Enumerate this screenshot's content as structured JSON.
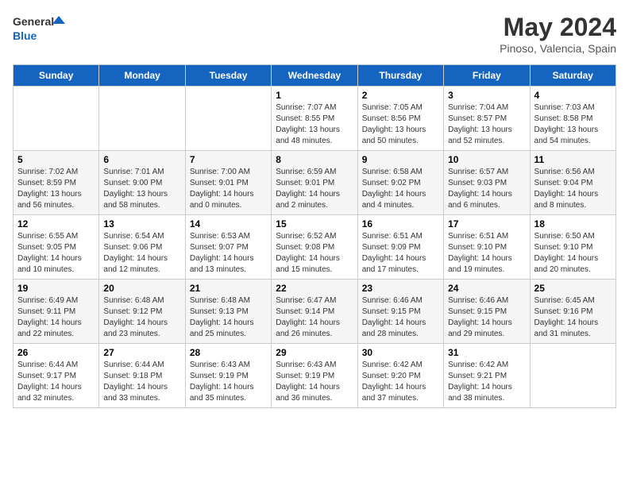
{
  "header": {
    "logo_general": "General",
    "logo_blue": "Blue",
    "title": "May 2024",
    "location": "Pinoso, Valencia, Spain"
  },
  "days_of_week": [
    "Sunday",
    "Monday",
    "Tuesday",
    "Wednesday",
    "Thursday",
    "Friday",
    "Saturday"
  ],
  "weeks": [
    [
      {
        "day": "",
        "info": ""
      },
      {
        "day": "",
        "info": ""
      },
      {
        "day": "",
        "info": ""
      },
      {
        "day": "1",
        "info": "Sunrise: 7:07 AM\nSunset: 8:55 PM\nDaylight: 13 hours\nand 48 minutes."
      },
      {
        "day": "2",
        "info": "Sunrise: 7:05 AM\nSunset: 8:56 PM\nDaylight: 13 hours\nand 50 minutes."
      },
      {
        "day": "3",
        "info": "Sunrise: 7:04 AM\nSunset: 8:57 PM\nDaylight: 13 hours\nand 52 minutes."
      },
      {
        "day": "4",
        "info": "Sunrise: 7:03 AM\nSunset: 8:58 PM\nDaylight: 13 hours\nand 54 minutes."
      }
    ],
    [
      {
        "day": "5",
        "info": "Sunrise: 7:02 AM\nSunset: 8:59 PM\nDaylight: 13 hours\nand 56 minutes."
      },
      {
        "day": "6",
        "info": "Sunrise: 7:01 AM\nSunset: 9:00 PM\nDaylight: 13 hours\nand 58 minutes."
      },
      {
        "day": "7",
        "info": "Sunrise: 7:00 AM\nSunset: 9:01 PM\nDaylight: 14 hours\nand 0 minutes."
      },
      {
        "day": "8",
        "info": "Sunrise: 6:59 AM\nSunset: 9:01 PM\nDaylight: 14 hours\nand 2 minutes."
      },
      {
        "day": "9",
        "info": "Sunrise: 6:58 AM\nSunset: 9:02 PM\nDaylight: 14 hours\nand 4 minutes."
      },
      {
        "day": "10",
        "info": "Sunrise: 6:57 AM\nSunset: 9:03 PM\nDaylight: 14 hours\nand 6 minutes."
      },
      {
        "day": "11",
        "info": "Sunrise: 6:56 AM\nSunset: 9:04 PM\nDaylight: 14 hours\nand 8 minutes."
      }
    ],
    [
      {
        "day": "12",
        "info": "Sunrise: 6:55 AM\nSunset: 9:05 PM\nDaylight: 14 hours\nand 10 minutes."
      },
      {
        "day": "13",
        "info": "Sunrise: 6:54 AM\nSunset: 9:06 PM\nDaylight: 14 hours\nand 12 minutes."
      },
      {
        "day": "14",
        "info": "Sunrise: 6:53 AM\nSunset: 9:07 PM\nDaylight: 14 hours\nand 13 minutes."
      },
      {
        "day": "15",
        "info": "Sunrise: 6:52 AM\nSunset: 9:08 PM\nDaylight: 14 hours\nand 15 minutes."
      },
      {
        "day": "16",
        "info": "Sunrise: 6:51 AM\nSunset: 9:09 PM\nDaylight: 14 hours\nand 17 minutes."
      },
      {
        "day": "17",
        "info": "Sunrise: 6:51 AM\nSunset: 9:10 PM\nDaylight: 14 hours\nand 19 minutes."
      },
      {
        "day": "18",
        "info": "Sunrise: 6:50 AM\nSunset: 9:10 PM\nDaylight: 14 hours\nand 20 minutes."
      }
    ],
    [
      {
        "day": "19",
        "info": "Sunrise: 6:49 AM\nSunset: 9:11 PM\nDaylight: 14 hours\nand 22 minutes."
      },
      {
        "day": "20",
        "info": "Sunrise: 6:48 AM\nSunset: 9:12 PM\nDaylight: 14 hours\nand 23 minutes."
      },
      {
        "day": "21",
        "info": "Sunrise: 6:48 AM\nSunset: 9:13 PM\nDaylight: 14 hours\nand 25 minutes."
      },
      {
        "day": "22",
        "info": "Sunrise: 6:47 AM\nSunset: 9:14 PM\nDaylight: 14 hours\nand 26 minutes."
      },
      {
        "day": "23",
        "info": "Sunrise: 6:46 AM\nSunset: 9:15 PM\nDaylight: 14 hours\nand 28 minutes."
      },
      {
        "day": "24",
        "info": "Sunrise: 6:46 AM\nSunset: 9:15 PM\nDaylight: 14 hours\nand 29 minutes."
      },
      {
        "day": "25",
        "info": "Sunrise: 6:45 AM\nSunset: 9:16 PM\nDaylight: 14 hours\nand 31 minutes."
      }
    ],
    [
      {
        "day": "26",
        "info": "Sunrise: 6:44 AM\nSunset: 9:17 PM\nDaylight: 14 hours\nand 32 minutes."
      },
      {
        "day": "27",
        "info": "Sunrise: 6:44 AM\nSunset: 9:18 PM\nDaylight: 14 hours\nand 33 minutes."
      },
      {
        "day": "28",
        "info": "Sunrise: 6:43 AM\nSunset: 9:19 PM\nDaylight: 14 hours\nand 35 minutes."
      },
      {
        "day": "29",
        "info": "Sunrise: 6:43 AM\nSunset: 9:19 PM\nDaylight: 14 hours\nand 36 minutes."
      },
      {
        "day": "30",
        "info": "Sunrise: 6:42 AM\nSunset: 9:20 PM\nDaylight: 14 hours\nand 37 minutes."
      },
      {
        "day": "31",
        "info": "Sunrise: 6:42 AM\nSunset: 9:21 PM\nDaylight: 14 hours\nand 38 minutes."
      },
      {
        "day": "",
        "info": ""
      }
    ]
  ]
}
